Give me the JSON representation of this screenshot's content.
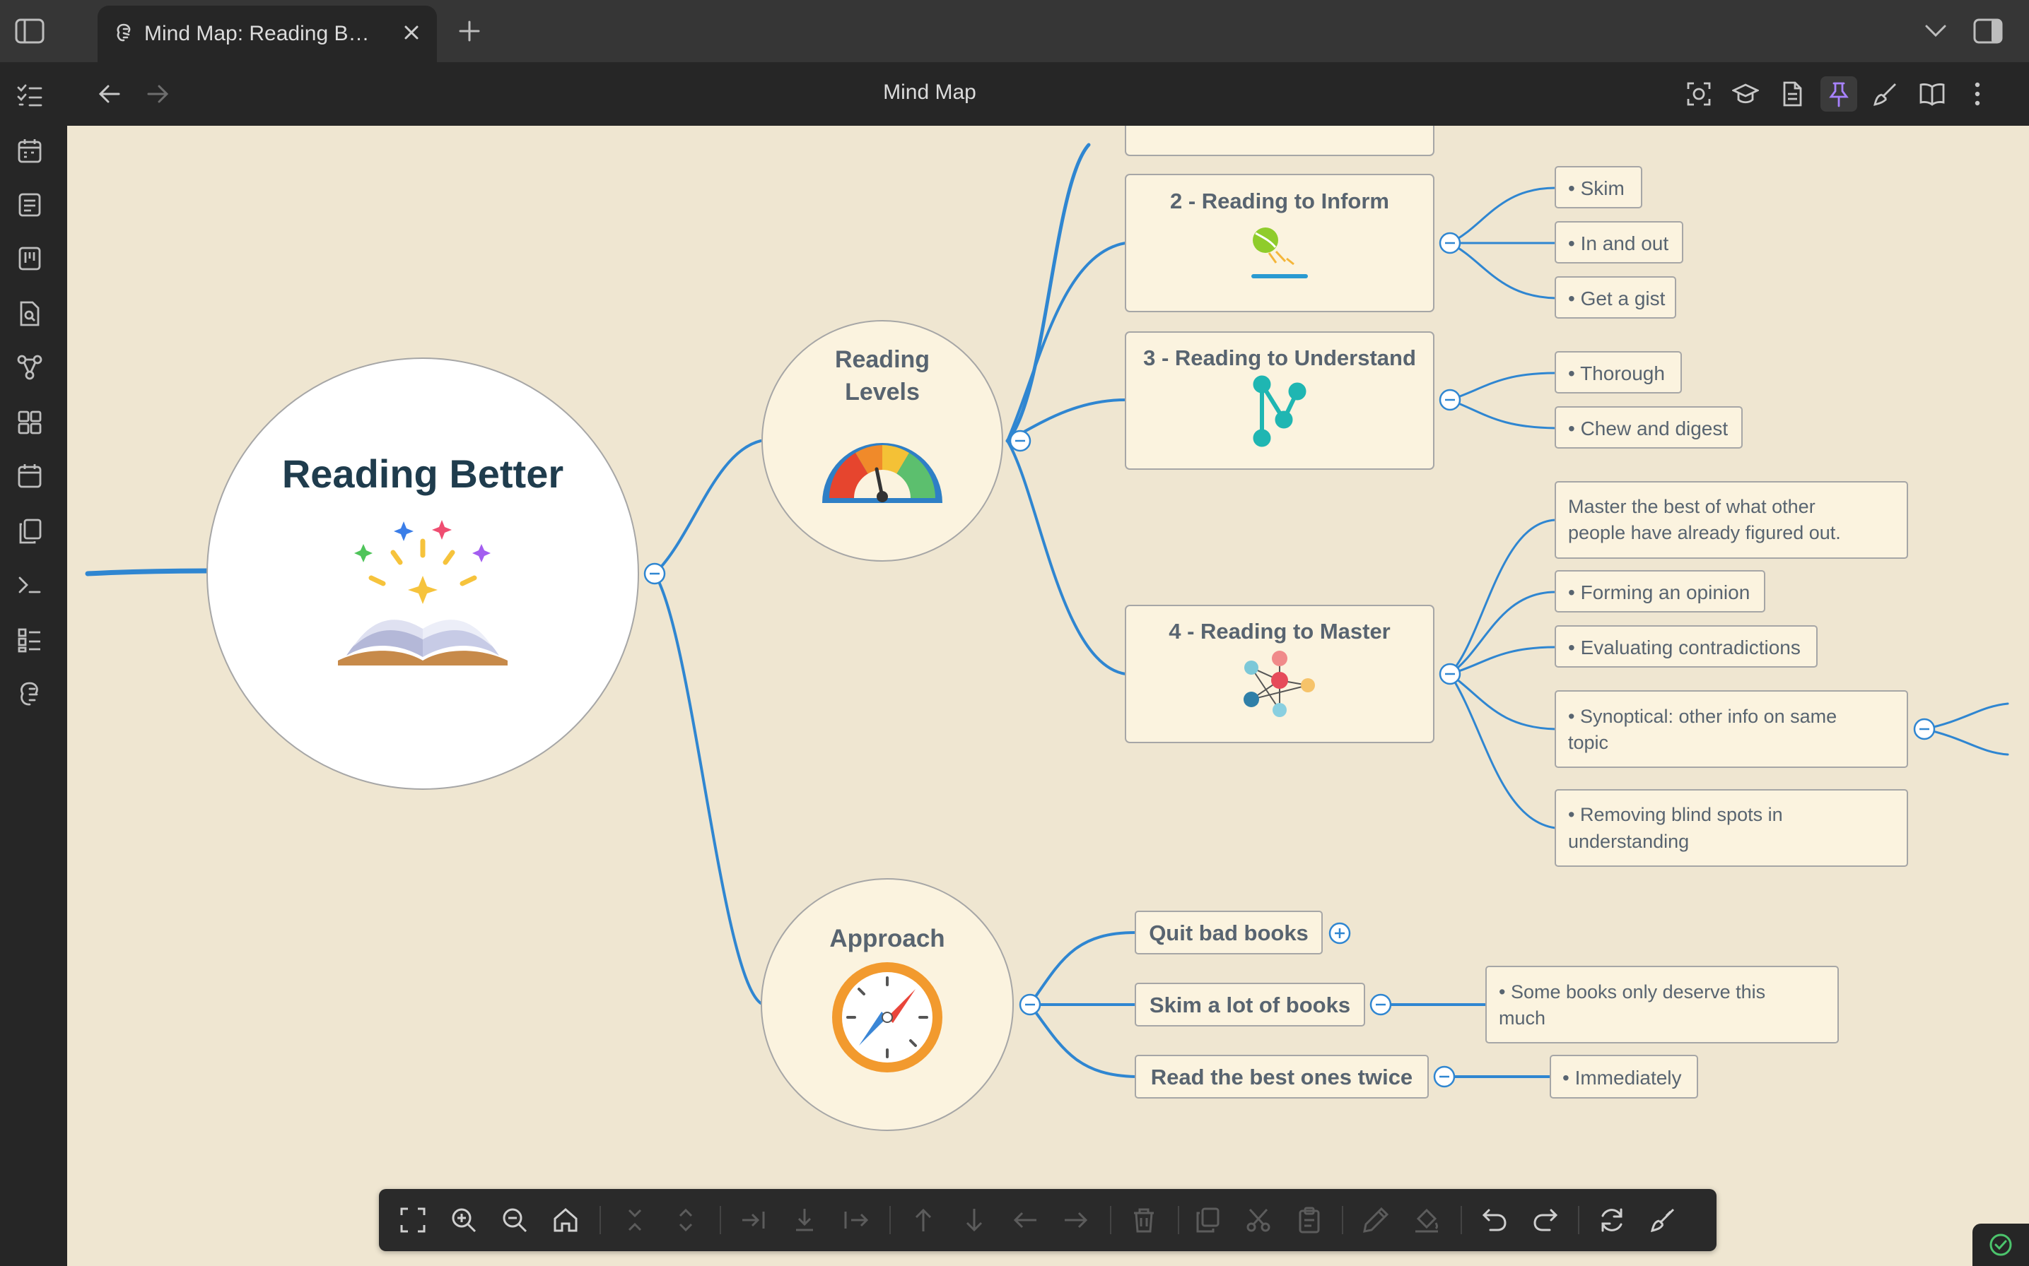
{
  "tabbar": {
    "tab_title": "Mind Map: Reading B…",
    "new_tab": "+"
  },
  "header": {
    "title": "Mind Map"
  },
  "mindmap": {
    "root": "Reading Better",
    "levels_line1": "Reading",
    "levels_line2": "Levels",
    "level2": "2 - Reading to Inform",
    "level3": "3 - Reading to Understand",
    "level4": "4 - Reading to Master",
    "skim": "• Skim",
    "in_and_out": "• In and out",
    "get_a_gist": "• Get a gist",
    "thorough": "• Thorough",
    "chew_and_digest": "• Chew and digest",
    "master_line1": "Master the best of what other",
    "master_line2": "people have already figured out.",
    "forming_opinion": "• Forming an opinion",
    "evaluating": "• Evaluating contradictions",
    "synoptical_line1": "• Synoptical: other info on same",
    "synoptical_line2": "topic",
    "blind_spots_line1": "• Removing blind spots in",
    "blind_spots_line2": "understanding",
    "approach": "Approach",
    "quit_bad_books": "Quit bad books",
    "skim_lot": "Skim a lot of books",
    "read_best": "Read the best ones twice",
    "some_books_line1": "• Some books only deserve this",
    "some_books_line2": "much",
    "immediately": "• Immediately"
  },
  "colors": {
    "branch": "#2f86d1",
    "canvas": "#efe6d1",
    "node_fill": "#fbf3df",
    "node_stroke": "#a6a6a6",
    "accent": "#a882ff"
  },
  "icons": {
    "ribbon": [
      "tasks-icon",
      "calendar-icon",
      "note-icon",
      "kanban-icon",
      "search-file-icon",
      "graph-icon",
      "dashboard-icon",
      "daily-note-icon",
      "copy-icon",
      "terminal-icon",
      "list-icon",
      "mindmap-icon"
    ],
    "header": [
      "focus-icon",
      "graduation-cap-icon",
      "document-icon",
      "pin-icon",
      "brush-icon",
      "reading-view-icon",
      "more-options-icon"
    ],
    "toolbar": [
      "fit-screen-icon",
      "zoom-in-icon",
      "zoom-out-icon",
      "home-icon",
      "collapse-icon",
      "expand-icon",
      "add-child-icon",
      "add-sibling-icon",
      "add-parent-icon",
      "move-up-icon",
      "move-down-icon",
      "move-left-icon",
      "move-right-icon",
      "delete-icon",
      "copy-icon",
      "cut-icon",
      "paste-icon",
      "pencil-icon",
      "fill-icon",
      "undo-icon",
      "redo-icon",
      "refresh-icon",
      "style-brush-icon"
    ]
  }
}
